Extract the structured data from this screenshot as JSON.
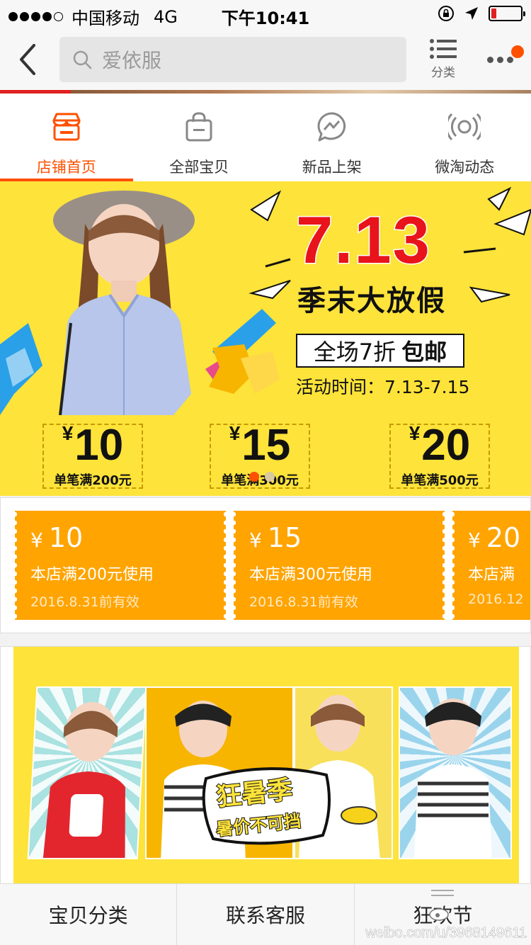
{
  "status_bar": {
    "carrier": "中国移动",
    "network": "4G",
    "time": "下午10:41",
    "battery_level": 0.15,
    "signal_bars": 4
  },
  "nav": {
    "search_placeholder": "爱依服",
    "category_label": "分类",
    "accent_color": "#ff5000"
  },
  "shop_tabs": [
    {
      "label": "店铺首页",
      "icon": "store-icon",
      "active": true
    },
    {
      "label": "全部宝贝",
      "icon": "bag-icon",
      "active": false
    },
    {
      "label": "新品上架",
      "icon": "chat-lightning-icon",
      "active": false
    },
    {
      "label": "微淘动态",
      "icon": "broadcast-icon",
      "active": false
    }
  ],
  "banner": {
    "title": "7.13",
    "subtitle": "季末大放假",
    "promo_text": "全场7折",
    "promo_bold": "包邮",
    "period": "活动时间：7.13-7.15",
    "coupons": [
      {
        "currency": "¥",
        "amount": "10",
        "condition": "单笔满200元"
      },
      {
        "currency": "¥",
        "amount": "15",
        "condition": "单笔满300元"
      },
      {
        "currency": "¥",
        "amount": "20",
        "condition": "单笔满500元"
      }
    ],
    "page_index": 1,
    "page_count": 2
  },
  "coupons": [
    {
      "currency": "¥",
      "amount": "10",
      "condition": "本店满200元使用",
      "valid": "2016.8.31前有效"
    },
    {
      "currency": "¥",
      "amount": "15",
      "condition": "本店满300元使用",
      "valid": "2016.8.31前有效"
    },
    {
      "currency": "¥",
      "amount": "20",
      "condition": "本店满",
      "valid": "2016.12"
    }
  ],
  "banner2": {
    "headline": "狂暑季",
    "tagline": "暑价不可挡"
  },
  "bottom_bar": [
    {
      "label": "宝贝分类"
    },
    {
      "label": "联系客服"
    },
    {
      "label": "狂欢节"
    }
  ],
  "watermark": "weibo.com/u/3968149611"
}
